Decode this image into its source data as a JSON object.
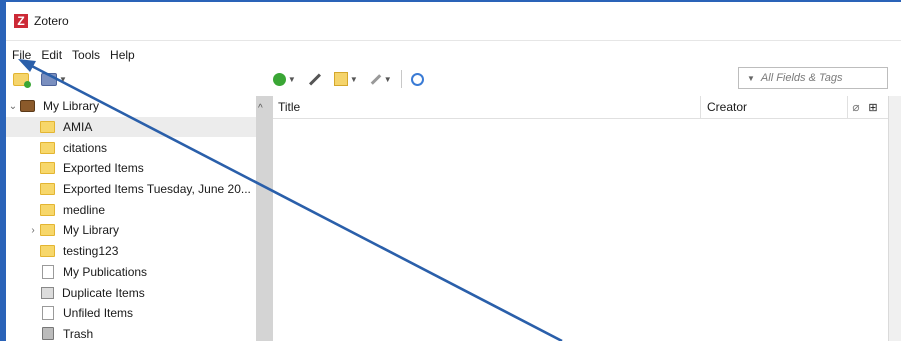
{
  "window": {
    "title": "Zotero",
    "logo_letter": "Z"
  },
  "menu": {
    "items": [
      {
        "label": "File"
      },
      {
        "label": "Edit"
      },
      {
        "label": "Tools"
      },
      {
        "label": "Help"
      }
    ]
  },
  "search": {
    "placeholder": "All Fields & Tags"
  },
  "collections": {
    "root": "My Library",
    "items": [
      {
        "label": "AMIA"
      },
      {
        "label": "citations"
      },
      {
        "label": "Exported Items"
      },
      {
        "label": "Exported Items Tuesday, June 20..."
      },
      {
        "label": "medline"
      },
      {
        "label": "My Library"
      },
      {
        "label": "testing123"
      },
      {
        "label": "My Publications"
      },
      {
        "label": "Duplicate Items"
      },
      {
        "label": "Unfiled Items"
      },
      {
        "label": "Trash"
      }
    ]
  },
  "items_table": {
    "columns": {
      "title": "Title",
      "creator": "Creator"
    }
  },
  "colors": {
    "accent_border": "#2a63b8",
    "arrow": "#2a5faa",
    "logo": "#cc2936"
  }
}
